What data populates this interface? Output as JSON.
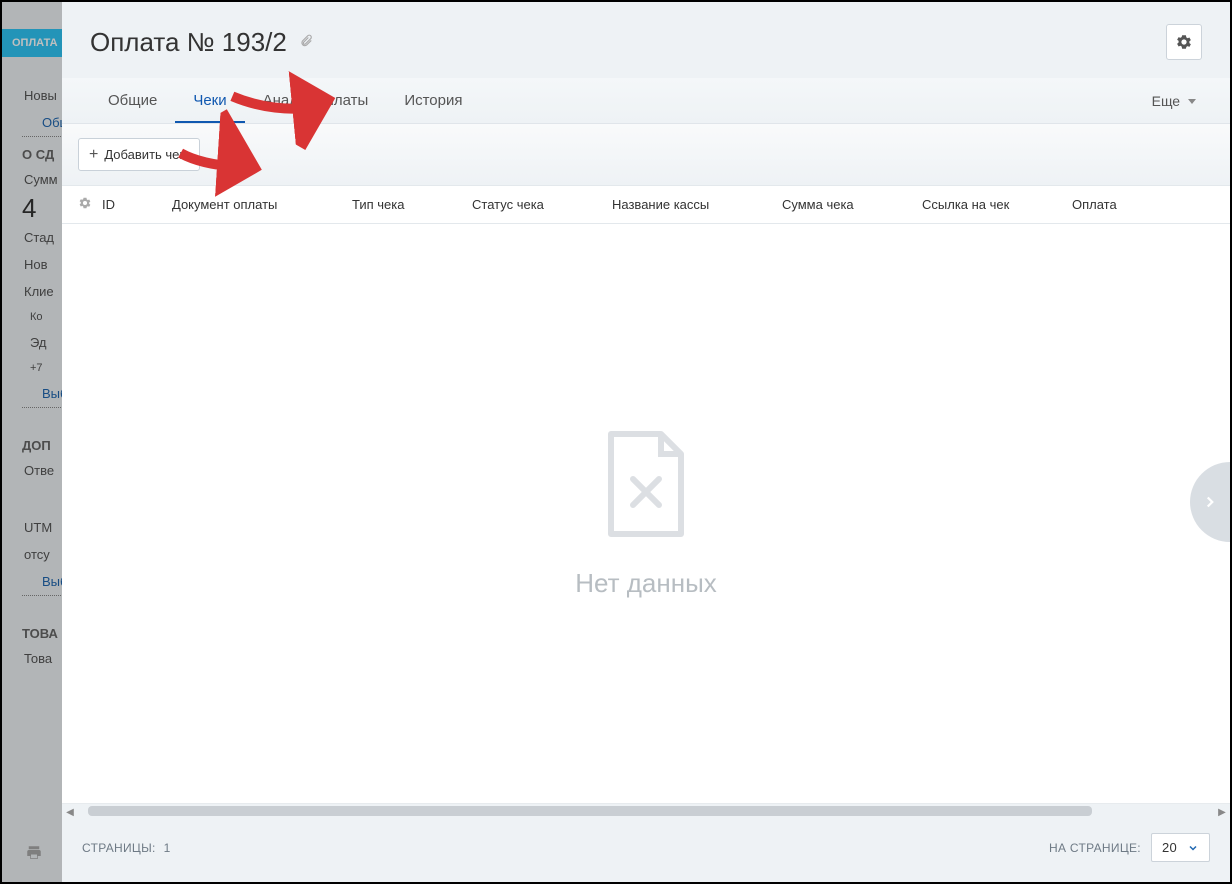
{
  "background": {
    "badge": "ОПЛАТА",
    "items": [
      "Новы",
      "Обц",
      "О СД",
      "Сумм",
      "4",
      "Стад",
      "Нов",
      "Клие",
      "Ко",
      "Эд",
      "+7",
      "Выб",
      "ДОП",
      "Отве",
      "UTM",
      "отсу",
      "Выб",
      "ТОВА",
      "Това"
    ]
  },
  "header": {
    "title": "Оплата № 193/2"
  },
  "tabs": {
    "items": [
      {
        "label": "Общие"
      },
      {
        "label": "Чеки"
      },
      {
        "label": "Анализ оплаты"
      },
      {
        "label": "История"
      }
    ],
    "more": "Еще"
  },
  "toolbar": {
    "add_check": "Добавить чек"
  },
  "columns": {
    "id": "ID",
    "doc": "Документ оплаты",
    "type": "Тип чека",
    "status": "Статус чека",
    "cash": "Название кассы",
    "sum": "Сумма чека",
    "link": "Ссылка на чек",
    "pay": "Оплата"
  },
  "empty": {
    "text": "Нет данных"
  },
  "footer": {
    "pages_label": "СТРАНИЦЫ:",
    "page": "1",
    "per_page_label": "НА СТРАНИЦЕ:",
    "per_page_value": "20"
  }
}
